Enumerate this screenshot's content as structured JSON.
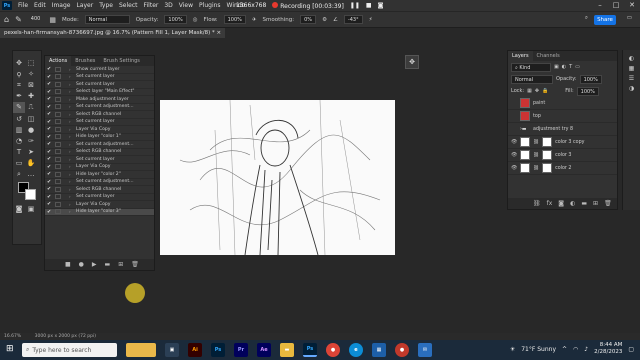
{
  "menubar": {
    "app_icon": "Ps",
    "items": [
      "File",
      "Edit",
      "Image",
      "Layer",
      "Type",
      "Select",
      "Filter",
      "3D",
      "View",
      "Plugins",
      "Windo"
    ],
    "recording": {
      "resolution": "1366x768",
      "status": "Recording [00:03:39]"
    }
  },
  "options": {
    "size": "400",
    "mode_label": "Mode:",
    "mode_value": "Normal",
    "opacity_label": "Opacity:",
    "opacity_value": "100%",
    "flow_label": "Flow:",
    "flow_value": "100%",
    "smoothing_label": "Smoothing:",
    "smoothing_value": "0%",
    "angle_value": "-43°",
    "share_label": "Share"
  },
  "document": {
    "tab_title": "pexels-han-firmansyah-8736697.jpg @ 16.7% (Pattern Fill 1, Layer Mask/8) *",
    "status": "3000 px x 2000 px (72 ppi)",
    "zoom": "16.67%"
  },
  "actions_panel": {
    "tabs": [
      "Actions",
      "Brushes",
      "Brush Settings"
    ],
    "active_tab": "Actions",
    "rows": [
      "Show current layer",
      "Set current layer",
      "Set current layer",
      "Select layer \"Main Effect\"",
      "Make adjustment layer",
      "Set current adjustment...",
      "Select RGB channel",
      "Set current layer",
      "Layer Via Copy",
      "Hide layer \"color 1\"",
      "Set current adjustment...",
      "Select RGB channel",
      "Set current layer",
      "Layer Via Copy",
      "Hide layer \"color 2\"",
      "Set current adjustment...",
      "Select RGB channel",
      "Set current layer",
      "Layer Via Copy",
      "Hide layer \"color 3\""
    ],
    "selected_index": 19
  },
  "layers_panel": {
    "tabs": [
      "Layers",
      "Channels"
    ],
    "kind_label": "Kind",
    "blend_mode": "Normal",
    "opacity_label": "Opacity:",
    "opacity_value": "100%",
    "lock_label": "Lock:",
    "fill_label": "Fill:",
    "fill_value": "100%",
    "layers": [
      {
        "name": "paint",
        "thumb": "red",
        "visible": false
      },
      {
        "name": "top",
        "thumb": "red",
        "visible": false
      },
      {
        "name": "adjustment try 8",
        "thumb": "folder",
        "visible": false
      },
      {
        "name": "color 3 copy",
        "thumb": "white",
        "visible": true
      },
      {
        "name": "color 3",
        "thumb": "white",
        "visible": true
      },
      {
        "name": "color 2",
        "thumb": "white",
        "visible": true
      }
    ]
  },
  "taskbar": {
    "search_placeholder": "Type here to search",
    "apps": [
      "Ai",
      "Ps",
      "Pr",
      "Ae",
      "Ps"
    ],
    "weather": "71°F  Sunny",
    "time": "8:44 AM",
    "date": "2/28/2023"
  }
}
